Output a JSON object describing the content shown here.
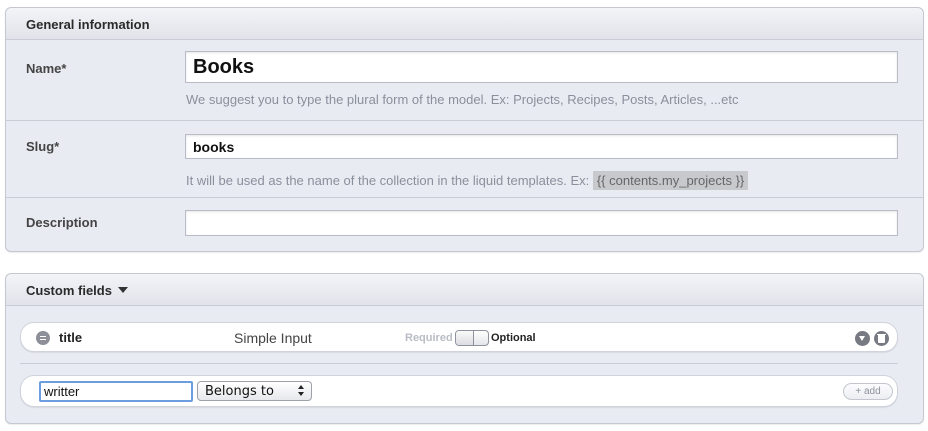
{
  "general": {
    "title": "General information",
    "name": {
      "label": "Name*",
      "value": "Books",
      "hint": "We suggest you to type the plural form of the model. Ex: Projects, Recipes, Posts, Articles, ...etc"
    },
    "slug": {
      "label": "Slug*",
      "value": "books",
      "hint_prefix": "It will be used as the name of the collection in the liquid templates. Ex: ",
      "hint_code": "{{ contents.my_projects }}"
    },
    "description": {
      "label": "Description",
      "value": ""
    }
  },
  "custom_fields": {
    "title": "Custom fields",
    "fields": [
      {
        "name": "title",
        "type": "Simple Input",
        "required_label": "Required",
        "optional_label": "Optional",
        "expand_icon": "chevron-down-icon",
        "delete_icon": "trash-icon"
      }
    ],
    "new_field": {
      "name_value": "writter",
      "type_selected": "Belongs to",
      "add_label": "+ add"
    }
  }
}
